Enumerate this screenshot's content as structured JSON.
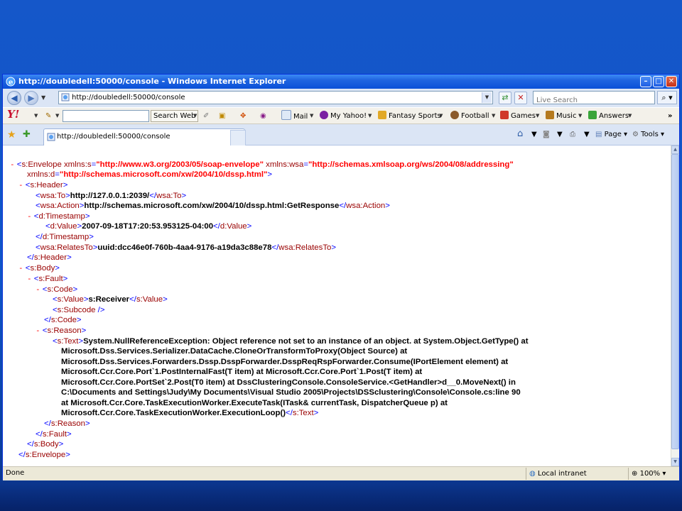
{
  "window": {
    "title": "http://doubledell:50000/console - Windows Internet Explorer"
  },
  "nav": {
    "address": "http://doubledell:50000/console",
    "search_placeholder": "Live Search"
  },
  "yahoo_toolbar": {
    "logo": "Y!",
    "search_web": "Search Web",
    "items": [
      "Mail",
      "My Yahoo!",
      "Fantasy Sports",
      "Football",
      "Games",
      "Music",
      "Answers"
    ],
    "more": "»"
  },
  "tabs": {
    "active_tab": "http://doubledell:50000/console",
    "tools": [
      "Page",
      "Tools"
    ]
  },
  "status": {
    "text": "Done",
    "zone": "Local intranet",
    "zoom": "100%"
  },
  "xml": {
    "ns_s": "http://www.w3.org/2003/05/soap-envelope",
    "ns_wsa": "http://schemas.xmlsoap.org/ws/2004/08/addressing",
    "ns_d": "http://schemas.microsoft.com/xw/2004/10/dssp.html",
    "to": "http://127.0.0.1:2039/",
    "action": "http://schemas.microsoft.com/xw/2004/10/dssp.html:GetResponse",
    "timestamp": "2007-09-18T17:20:53.953125-04:00",
    "relates_to": "uuid:dcc46e0f-760b-4aa4-9176-a19da3c88e78",
    "code_value": "s:Receiver",
    "reason_lines": [
      "System.NullReferenceException: Object reference not set to an instance of an object. at System.Object.GetType() at",
      "Microsoft.Dss.Services.Serializer.DataCache.CloneOrTransformToProxy(Object Source) at",
      "Microsoft.Dss.Services.Forwarders.Dssp.DsspForwarder.DsspReqRspForwarder.Consume(IPortElement element) at",
      "Microsoft.Ccr.Core.Port`1.PostInternalFast(T item) at Microsoft.Ccr.Core.Port`1.Post(T item) at",
      "Microsoft.Ccr.Core.PortSet`2.Post(T0 item) at DssClusteringConsole.ConsoleService.<GetHandler>d__0.MoveNext() in",
      "C:\\Documents and Settings\\Judy\\My Documents\\Visual Studio 2005\\Projects\\DSSclustering\\Console\\Console.cs:line 90",
      "at Microsoft.Ccr.Core.TaskExecutionWorker.ExecuteTask(ITask& currentTask, DispatcherQueue p) at",
      "Microsoft.Ccr.Core.TaskExecutionWorker.ExecutionLoop()"
    ]
  }
}
